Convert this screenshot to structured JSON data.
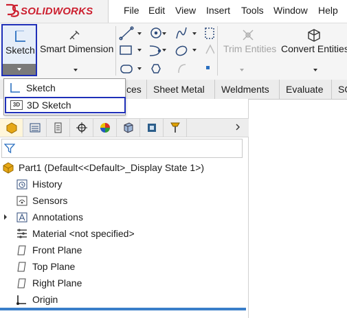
{
  "app": {
    "brand": "SOLIDWORKS"
  },
  "menu": [
    "File",
    "Edit",
    "View",
    "Insert",
    "Tools",
    "Window",
    "Help"
  ],
  "ribbon": {
    "sketch_label": "Sketch",
    "smart_dimension_label": "Smart Dimension",
    "trim_entities_label": "Trim Entities",
    "convert_entities_label": "Convert Entities"
  },
  "tabs": [
    "ces",
    "Sheet Metal",
    "Weldments",
    "Evaluate",
    "SO"
  ],
  "dropdown": {
    "items": [
      {
        "label": "Sketch",
        "icon": "sketch-icon"
      },
      {
        "label": "3D Sketch",
        "icon": "3d-sketch-icon",
        "badge": "3D"
      }
    ]
  },
  "tree": {
    "root": "Part1  (Default<<Default>_Display State 1>)",
    "items": [
      {
        "label": "History",
        "icon": "history-icon"
      },
      {
        "label": "Sensors",
        "icon": "sensors-icon"
      },
      {
        "label": "Annotations",
        "icon": "annotations-icon"
      },
      {
        "label": "Material <not specified>",
        "icon": "material-icon"
      },
      {
        "label": "Front Plane",
        "icon": "plane-icon"
      },
      {
        "label": "Top Plane",
        "icon": "plane-icon"
      },
      {
        "label": "Right Plane",
        "icon": "plane-icon"
      },
      {
        "label": "Origin",
        "icon": "origin-icon"
      }
    ]
  },
  "colors": {
    "brand_red": "#cc1f2f",
    "highlight_blue": "#1e2fb8",
    "accent_blue": "#3a7ec9"
  }
}
